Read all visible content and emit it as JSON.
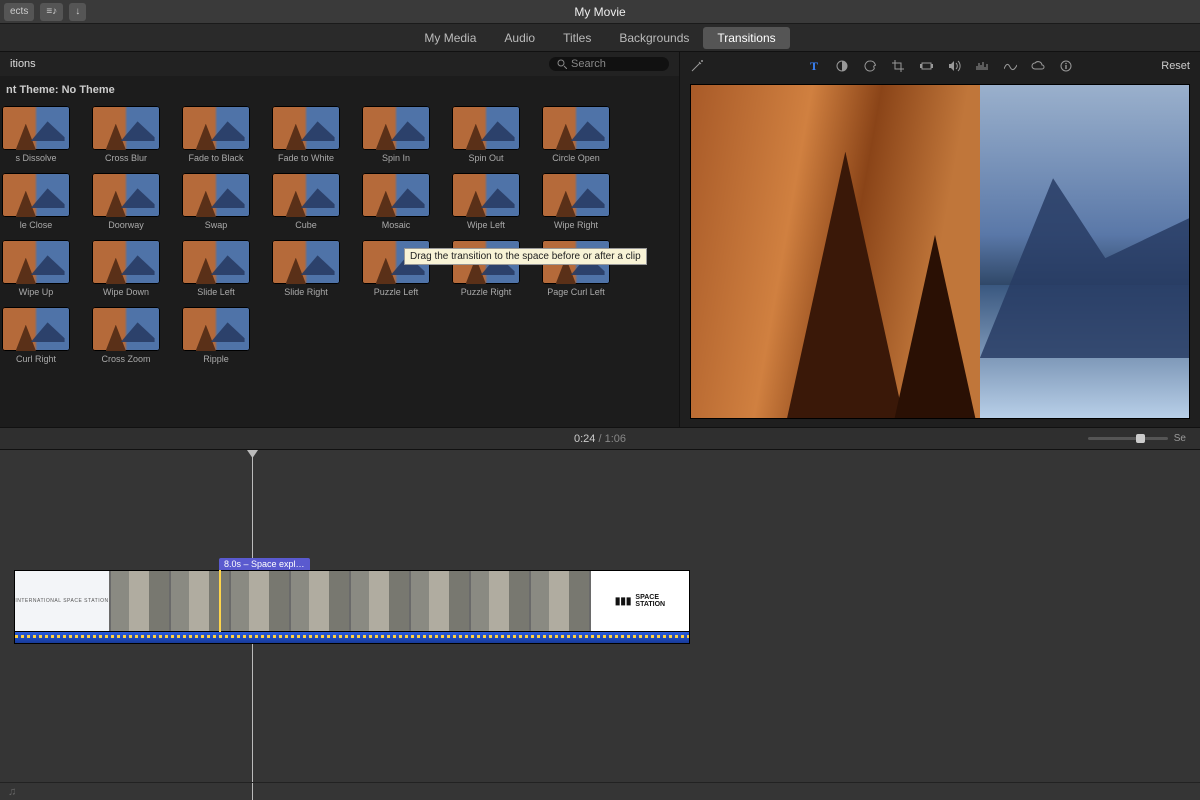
{
  "titlebar": {
    "title": "My Movie",
    "left_buttons": {
      "projects": "ects",
      "media": "≡♪",
      "import": "↓"
    }
  },
  "tabs": [
    "My Media",
    "Audio",
    "Titles",
    "Backgrounds",
    "Transitions"
  ],
  "active_tab": "Transitions",
  "browser": {
    "section_title": "itions",
    "search_placeholder": "Search",
    "theme_label": "nt Theme: No Theme",
    "transitions": [
      "s Dissolve",
      "Cross Blur",
      "Fade to Black",
      "Fade to White",
      "Spin In",
      "Spin Out",
      "Circle Open",
      "le Close",
      "Doorway",
      "Swap",
      "Cube",
      "Mosaic",
      "Wipe Left",
      "Wipe Right",
      "Wipe Up",
      "Wipe Down",
      "Slide Left",
      "Slide Right",
      "Puzzle Left",
      "Puzzle Right",
      "Page Curl Left",
      "Curl Right",
      "Cross Zoom",
      "Ripple"
    ],
    "tooltip": "Drag the transition to the space before or after a clip"
  },
  "viewer": {
    "reset_label": "Reset",
    "tool_icons": [
      "wand-icon",
      "text-icon",
      "contrast-icon",
      "palette-icon",
      "crop-icon",
      "stabilize-icon",
      "volume-icon",
      "noise-icon",
      "eq-icon",
      "cloud-icon",
      "info-icon"
    ]
  },
  "time": {
    "current": "0:24",
    "total": "1:06",
    "zoom_suffix": "Se"
  },
  "timeline": {
    "clip_label": "8.0s – Space expl…",
    "intro_title": "INTERNATIONAL SPACE STATION",
    "outro_title": "SPACE\nSTATION",
    "music_icon": "♫"
  }
}
